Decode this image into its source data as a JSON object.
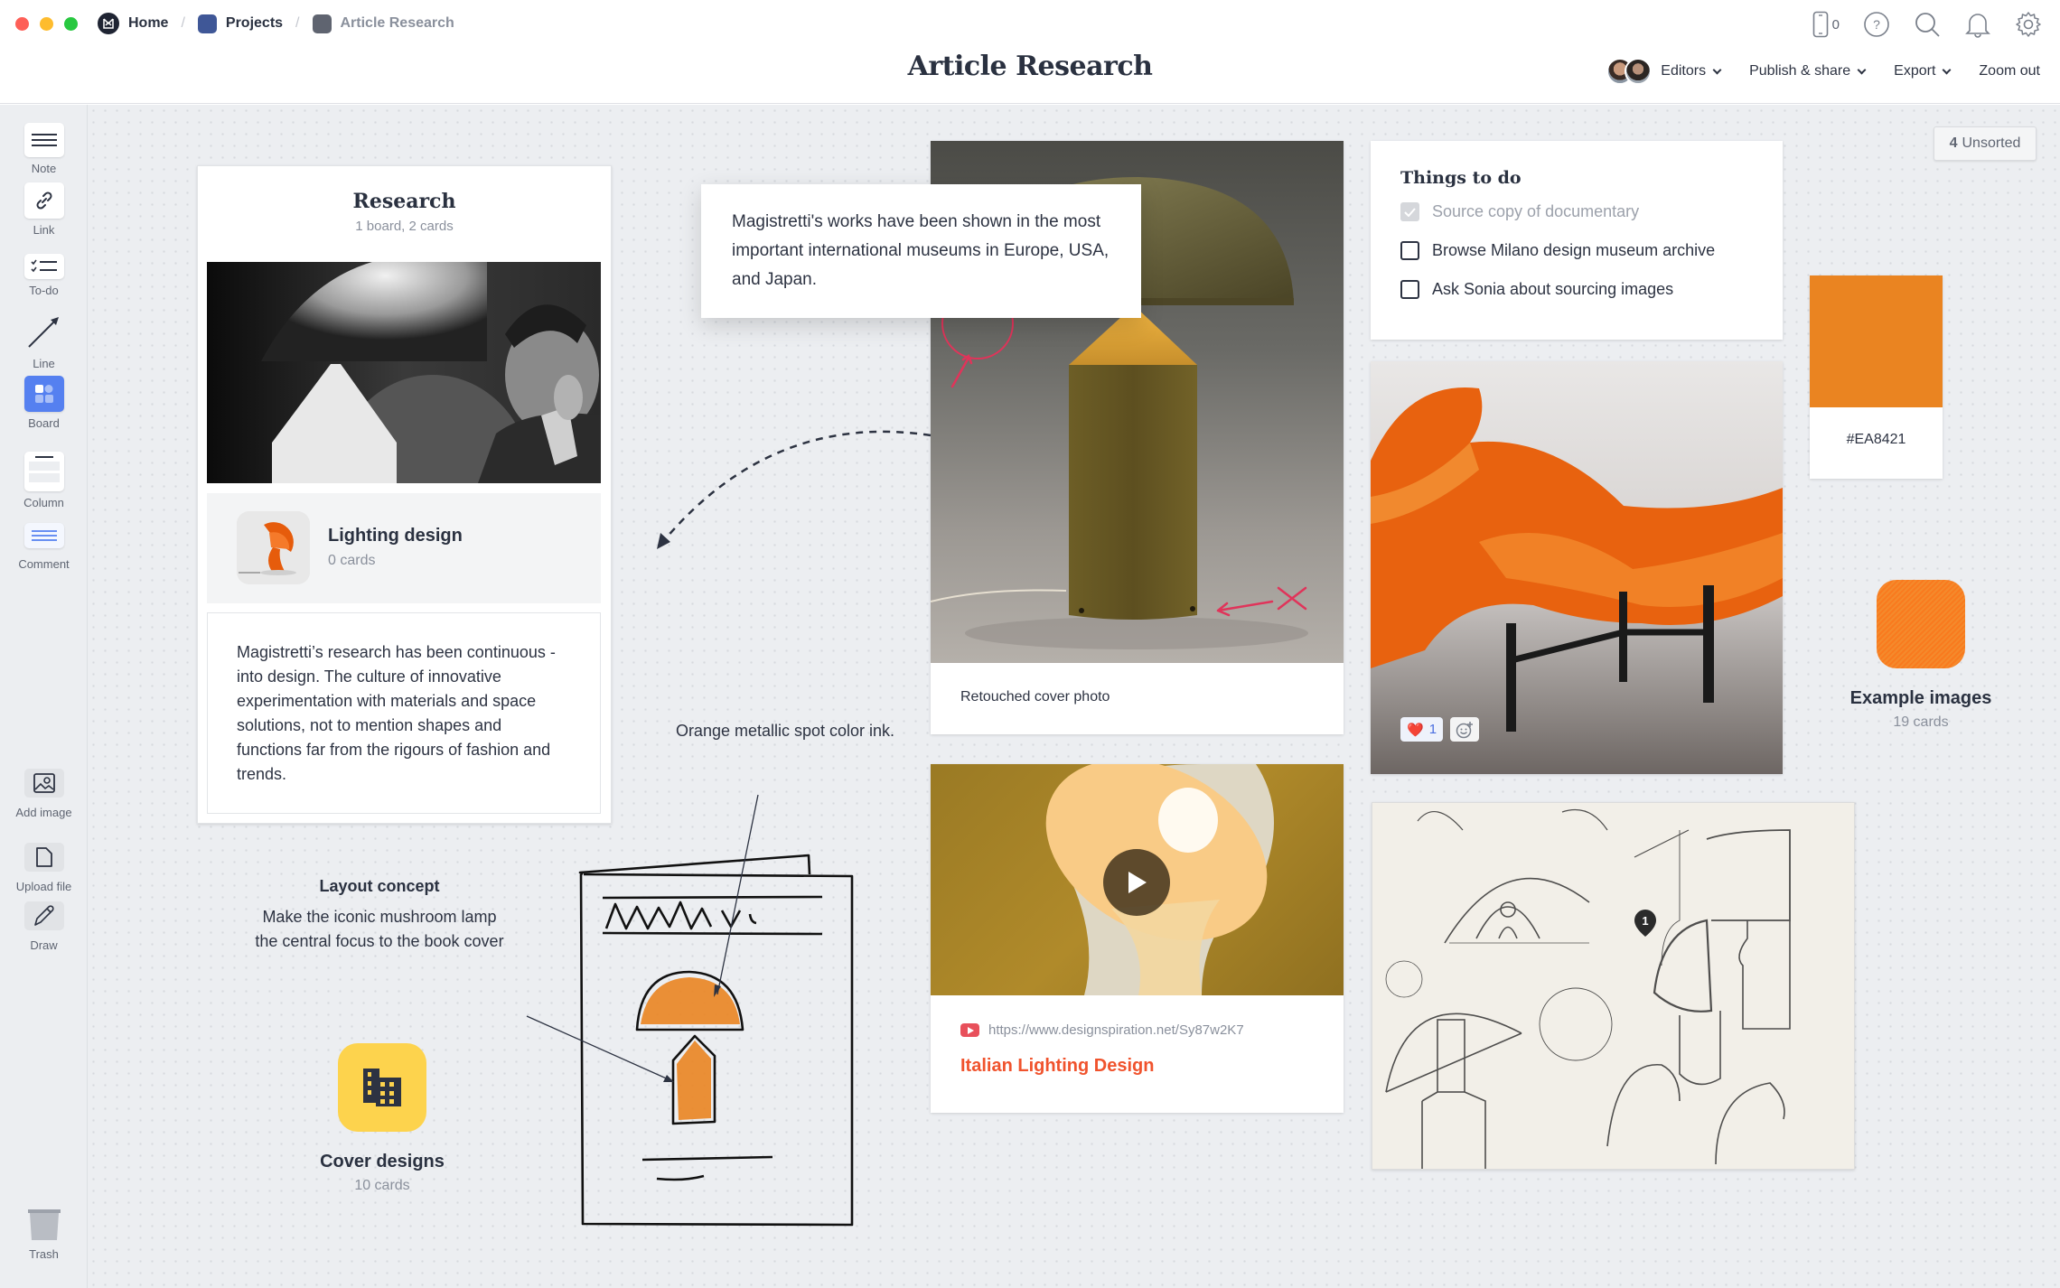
{
  "window": {
    "traffic_lights": [
      "#fe5f57",
      "#febc2e",
      "#28c840"
    ]
  },
  "breadcrumb": [
    {
      "label": "Home",
      "icon": "milanote-logo-icon"
    },
    {
      "label": "Projects",
      "color": "#3f5797"
    },
    {
      "label": "Article Research",
      "color": "#5f6470"
    }
  ],
  "header": {
    "title": "Article Research",
    "phone_count": "0",
    "icons": [
      "phone-icon",
      "help-icon",
      "search-icon",
      "bell-icon",
      "gear-icon"
    ],
    "toolbar": {
      "editors": "Editors",
      "publish": "Publish & share",
      "export": "Export",
      "zoom": "Zoom out"
    }
  },
  "sidebar": {
    "tools": [
      {
        "label": "Note",
        "icon": "note-icon"
      },
      {
        "label": "Link",
        "icon": "link-icon"
      },
      {
        "label": "To-do",
        "icon": "todo-icon"
      },
      {
        "label": "Line",
        "icon": "line-arrow-icon"
      },
      {
        "label": "Board",
        "icon": "board-icon"
      },
      {
        "label": "Column",
        "icon": "column-icon"
      },
      {
        "label": "Comment",
        "icon": "comment-icon"
      },
      {
        "label": "Add image",
        "icon": "image-icon"
      },
      {
        "label": "Upload file",
        "icon": "file-icon"
      },
      {
        "label": "Draw",
        "icon": "pencil-icon"
      }
    ],
    "trash": "Trash"
  },
  "research": {
    "title": "Research",
    "subtitle": "1 board, 2 cards",
    "subboard": {
      "name": "Lighting design",
      "count": "0 cards"
    },
    "note": "Magistretti’s research has been continuous - into design. The culture of innovative experimentation with materials and space solutions, not to mention shapes and functions far from the rigours of fashion and trends."
  },
  "quote_note": "Magistretti's works have been shown in the most important international museums in Europe, USA, and Japan.",
  "lamp_card": {
    "caption": "Retouched cover photo"
  },
  "video_card": {
    "url": "https://www.designspiration.net/Sy87w2K7",
    "title": "Italian Lighting Design"
  },
  "todo": {
    "title": "Things to do",
    "items": [
      {
        "text": "Source copy of documentary",
        "done": true
      },
      {
        "text": "Browse Milano design museum archive",
        "done": false
      },
      {
        "text": "Ask Sonia about sourcing images",
        "done": false
      }
    ]
  },
  "chair_card": {
    "reactions": [
      {
        "emoji": "❤️",
        "count": "1"
      }
    ]
  },
  "sketch_card": {
    "comment_pin": "1"
  },
  "swatch": {
    "hex": "#EA8421",
    "color": "#EA8421"
  },
  "unsorted": {
    "count": "4",
    "label": "Unsorted"
  },
  "example_images": {
    "name": "Example images",
    "count": "19 cards"
  },
  "cover_designs": {
    "name": "Cover designs",
    "count": "10 cards"
  },
  "layout_concept": {
    "heading": "Layout concept",
    "body": "Make the iconic mushroom lamp the central focus to the book cover"
  },
  "ink_note": "Orange metallic spot color ink."
}
